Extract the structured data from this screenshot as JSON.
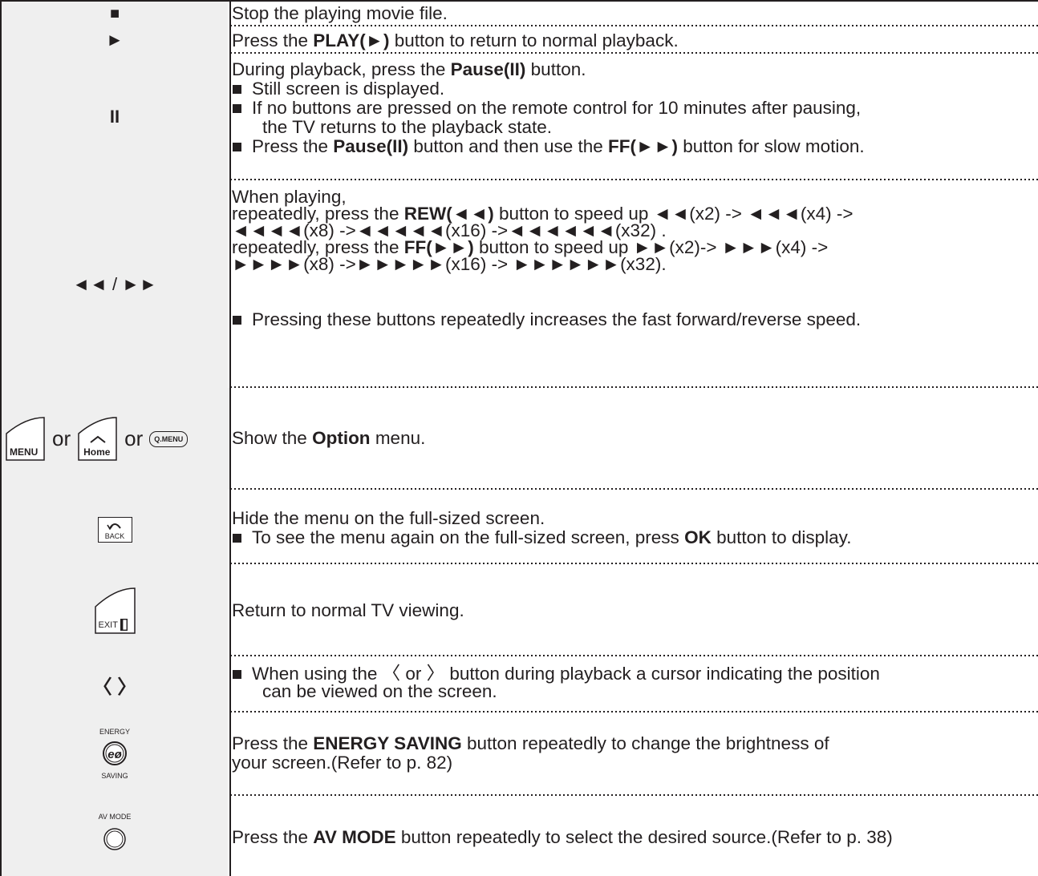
{
  "rows": [
    {
      "key": "■",
      "text": [
        "Stop the playing movie file."
      ]
    },
    {
      "key": "►",
      "pre": "Press the ",
      "bold": "PLAY(►)",
      "post": " button to return to normal playback."
    },
    {
      "key": "II",
      "line1_pre": "During playback, press the ",
      "line1_bold": "Pause(II)",
      "line1_post": " button.",
      "b1": "Still screen is displayed.",
      "b2a": "If no buttons are pressed on the remote control for 10 minutes after pausing,",
      "b2b": "the TV returns to the playback state.",
      "b3_pre": "Press the ",
      "b3_bold1": "Pause(II)",
      "b3_mid": " button and then use the ",
      "b3_bold2": "FF(►►)",
      "b3_post": " button for slow motion."
    },
    {
      "key": "◄◄ / ►►",
      "l1": "When playing,",
      "l2_pre": "repeatedly, press the ",
      "l2_bold": "REW(◄◄)",
      "l2_post": " button to speed up ◄◄(x2) -> ◄◄◄(x4) ->",
      "l3": "◄◄◄◄(x8) ->◄◄◄◄◄(x16) ->◄◄◄◄◄◄(x32) .",
      "l4_pre": "repeatedly, press the ",
      "l4_bold": "FF(►►)",
      "l4_post": " button to speed up ►►(x2)-> ►►►(x4) ->",
      "l5": "►►►►(x8) ->►►►►►(x16) -> ►►►►►►(x32).",
      "bullet": "Pressing these buttons repeatedly increases the fast forward/reverse speed."
    },
    {
      "key_menu": "MENU",
      "key_or1": "or",
      "key_home": "Home",
      "key_or2": "or",
      "key_qmenu": "Q.MENU",
      "pre": "Show the ",
      "bold": "Option",
      "post": " menu."
    },
    {
      "key_back": "BACK",
      "l1": "Hide the menu on the full-sized screen.",
      "b_pre": "To see the menu again on the full-sized screen, press ",
      "b_bold": "OK",
      "b_post": " button to display."
    },
    {
      "key_exit": "EXIT",
      "text": "Return to normal TV viewing."
    },
    {
      "key": "〈 〉",
      "b1": "When using the 〈 or 〉 button during playback a cursor indicating the position",
      "b2": "can be viewed on the screen."
    },
    {
      "key_top": "ENERGY",
      "key_bottom": "SAVING",
      "pre": "Press the ",
      "bold": "ENERGY SAVING",
      "post": " button repeatedly to change the brightness of",
      "l2": "your screen.(Refer to p. 82)"
    },
    {
      "key_top": "AV MODE",
      "pre": "Press the ",
      "bold": "AV MODE",
      "post": " button repeatedly to select the desired source.(Refer to p. 38)"
    }
  ]
}
